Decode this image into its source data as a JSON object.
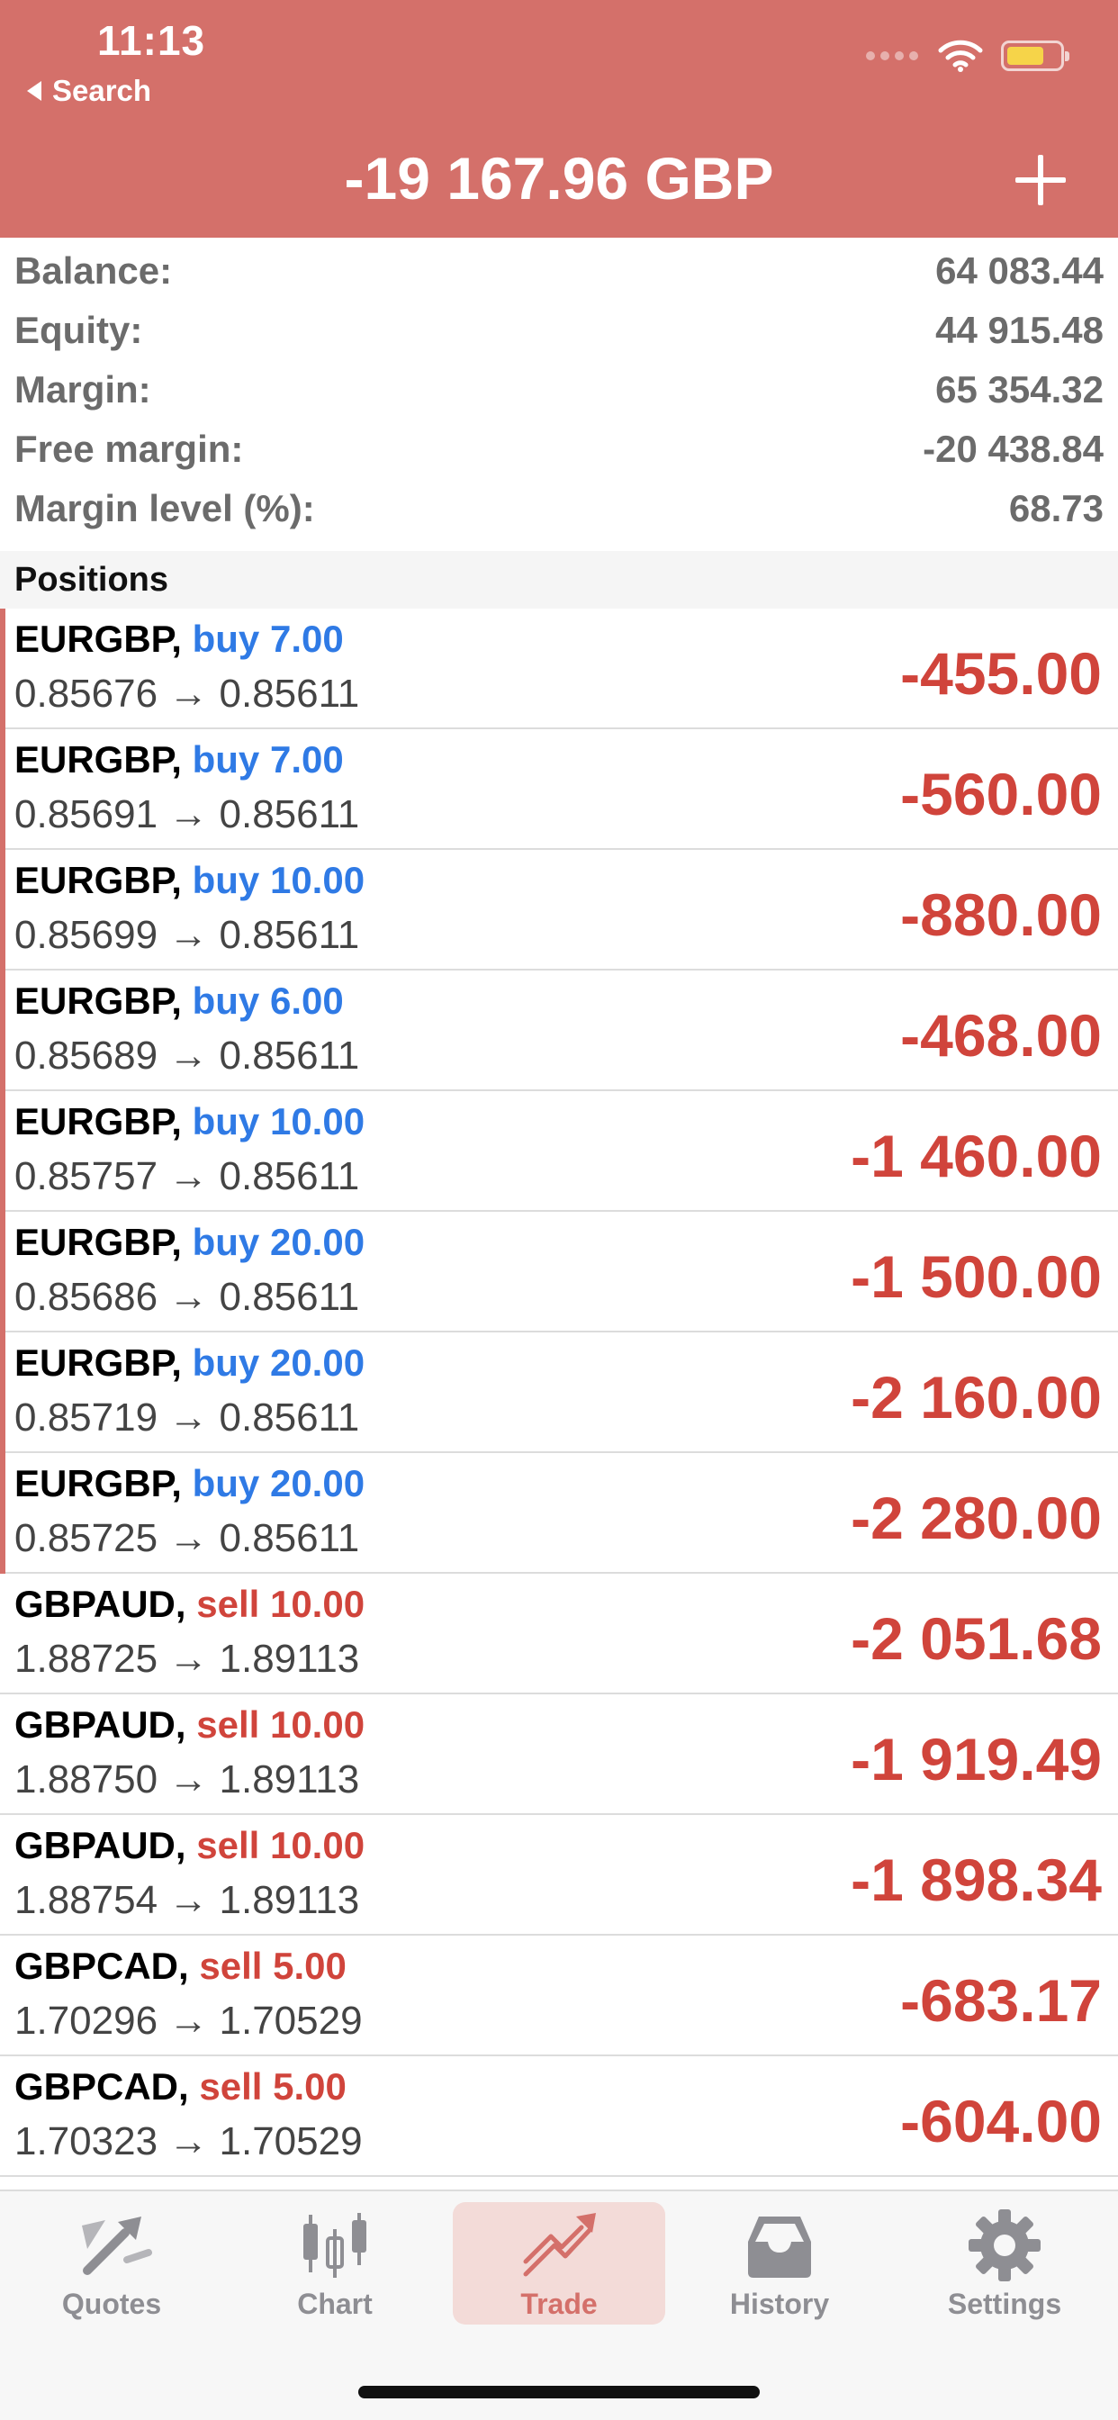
{
  "status_bar": {
    "time": "11:13",
    "back_label": "Search"
  },
  "header": {
    "total_profit": "-19 167.96 GBP"
  },
  "summary": [
    {
      "label": "Balance:",
      "value": "64 083.44"
    },
    {
      "label": "Equity:",
      "value": "44 915.48"
    },
    {
      "label": "Margin:",
      "value": "65 354.32"
    },
    {
      "label": "Free margin:",
      "value": "-20 438.84"
    },
    {
      "label": "Margin level (%):",
      "value": "68.73"
    }
  ],
  "positions_header": "Positions",
  "positions": [
    {
      "symbol": "EURGBP,",
      "type": "buy",
      "type_label": "buy 7.00",
      "prices": "0.85676 → 0.85611",
      "profit": "-455.00"
    },
    {
      "symbol": "EURGBP,",
      "type": "buy",
      "type_label": "buy 7.00",
      "prices": "0.85691 → 0.85611",
      "profit": "-560.00"
    },
    {
      "symbol": "EURGBP,",
      "type": "buy",
      "type_label": "buy 10.00",
      "prices": "0.85699 → 0.85611",
      "profit": "-880.00"
    },
    {
      "symbol": "EURGBP,",
      "type": "buy",
      "type_label": "buy 6.00",
      "prices": "0.85689 → 0.85611",
      "profit": "-468.00"
    },
    {
      "symbol": "EURGBP,",
      "type": "buy",
      "type_label": "buy 10.00",
      "prices": "0.85757 → 0.85611",
      "profit": "-1 460.00"
    },
    {
      "symbol": "EURGBP,",
      "type": "buy",
      "type_label": "buy 20.00",
      "prices": "0.85686 → 0.85611",
      "profit": "-1 500.00"
    },
    {
      "symbol": "EURGBP,",
      "type": "buy",
      "type_label": "buy 20.00",
      "prices": "0.85719 → 0.85611",
      "profit": "-2 160.00"
    },
    {
      "symbol": "EURGBP,",
      "type": "buy",
      "type_label": "buy 20.00",
      "prices": "0.85725 → 0.85611",
      "profit": "-2 280.00"
    },
    {
      "symbol": "GBPAUD,",
      "type": "sell",
      "type_label": "sell 10.00",
      "prices": "1.88725 → 1.89113",
      "profit": "-2 051.68"
    },
    {
      "symbol": "GBPAUD,",
      "type": "sell",
      "type_label": "sell 10.00",
      "prices": "1.88750 → 1.89113",
      "profit": "-1 919.49"
    },
    {
      "symbol": "GBPAUD,",
      "type": "sell",
      "type_label": "sell 10.00",
      "prices": "1.88754 → 1.89113",
      "profit": "-1 898.34"
    },
    {
      "symbol": "GBPCAD,",
      "type": "sell",
      "type_label": "sell 5.00",
      "prices": "1.70296 → 1.70529",
      "profit": "-683.17"
    },
    {
      "symbol": "GBPCAD,",
      "type": "sell",
      "type_label": "sell 5.00",
      "prices": "1.70323 → 1.70529",
      "profit": "-604.00"
    }
  ],
  "tabs": [
    {
      "label": "Quotes",
      "icon": "quotes-icon"
    },
    {
      "label": "Chart",
      "icon": "chart-icon"
    },
    {
      "label": "Trade",
      "icon": "trade-icon",
      "active": true
    },
    {
      "label": "History",
      "icon": "history-icon"
    },
    {
      "label": "Settings",
      "icon": "settings-icon"
    }
  ],
  "colors": {
    "accent": "#d4706a",
    "buy": "#2f7ae5",
    "sell": "#d0443b",
    "loss": "#d0443b",
    "battery": "#f6d449"
  }
}
